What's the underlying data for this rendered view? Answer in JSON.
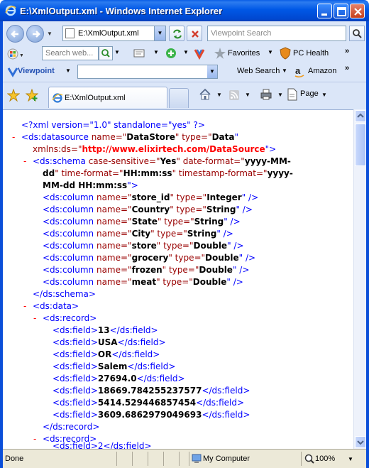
{
  "window": {
    "title": "E:\\XmlOutput.xml - Windows Internet Explorer"
  },
  "address_bar": {
    "value": "E:\\XmlOutput.xml",
    "search_placeholder": "Viewpoint Search"
  },
  "toolbar_row2": {
    "search_placeholder": "Search web...",
    "favorites_label": "Favorites",
    "pc_health_label": "PC Health"
  },
  "toolbar_row3": {
    "viewpoint_label": "Viewpoint",
    "web_search_label": "Web Search",
    "amazon_label": "Amazon"
  },
  "tabs": [
    {
      "label": "E:\\XmlOutput.xml"
    }
  ],
  "command_bar": {
    "page_label": "Page"
  },
  "xml": {
    "pi": "<?xml version=\"1.0\" standalone=\"yes\" ?>",
    "minus": "-",
    "datasource_open": "<ds:datasource",
    "a_name": "name=\"",
    "v_datastore": "DataStore",
    "a_type": "\" type=\"",
    "v_data": "Data",
    "q_close": "\"",
    "xmlns": "xmlns:ds=\"",
    "v_ns": "http://www.elixirtech.com/DataSource",
    "q_gt": "\">",
    "schema_open": "<ds:schema",
    "a_case": "case-sensitive=\"",
    "v_yes": "Yes",
    "a_date": "\" date-format=\"",
    "v_date1": "yyyy-MM-",
    "v_date2": "dd",
    "a_time": "\" time-format=\"",
    "v_time": "HH:mm:ss",
    "a_ts": "\" timestamp-format=\"",
    "v_ts1": "yyyy-",
    "v_ts2": "MM-dd HH:mm:ss",
    "col_open": "<ds:column",
    "type_close": "\" />",
    "columns": [
      {
        "name": "store_id",
        "type": "Integer"
      },
      {
        "name": "Country",
        "type": "String"
      },
      {
        "name": "State",
        "type": "String"
      },
      {
        "name": "City",
        "type": "String"
      },
      {
        "name": "store",
        "type": "Double"
      },
      {
        "name": "grocery",
        "type": "Double"
      },
      {
        "name": "frozen",
        "type": "Double"
      },
      {
        "name": "meat",
        "type": "Double"
      }
    ],
    "schema_close": "</ds:schema>",
    "data_open": "<ds:data>",
    "record_open": "<ds:record>",
    "field_open": "<ds:field>",
    "field_close": "</ds:field>",
    "record1_fields": [
      "13",
      "USA",
      "OR",
      "Salem",
      "27694.0",
      "18669.784255237577",
      "5414.529446857454",
      "3609.6862979049693"
    ],
    "record_close": "</ds:record>",
    "partial_line": "<ds:field>2</ds:field>"
  },
  "status_bar": {
    "left_text": "Done",
    "zone": "My Computer",
    "zoom": "100%"
  }
}
